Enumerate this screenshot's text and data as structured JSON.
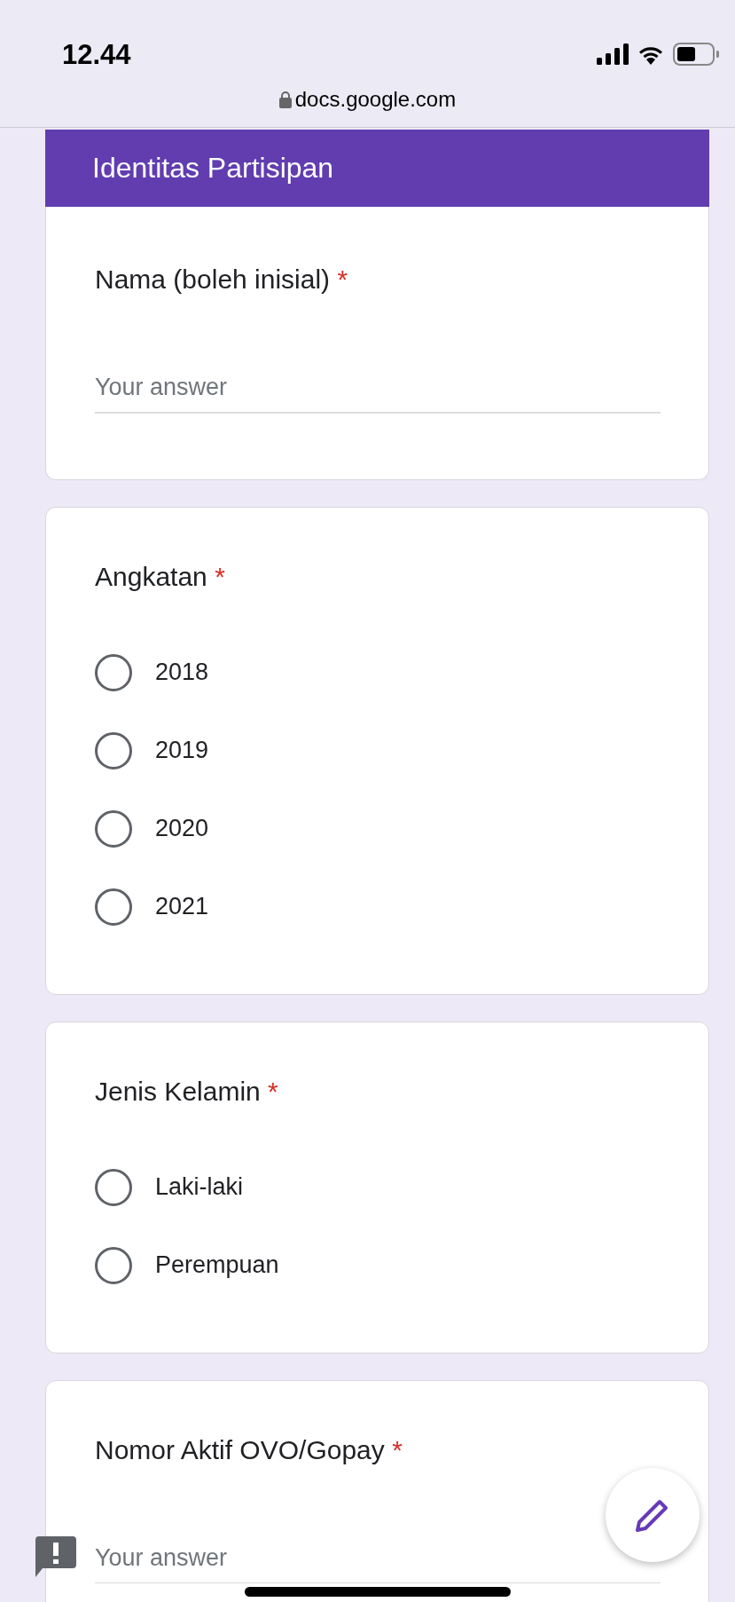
{
  "status_bar": {
    "time": "12.44"
  },
  "url_bar": {
    "url": "docs.google.com"
  },
  "form": {
    "section_title": "Identitas Partisipan",
    "questions": [
      {
        "kind": "text",
        "title": "Nama (boleh inisial)",
        "required_mark": "*",
        "placeholder": "Your answer"
      },
      {
        "kind": "radio",
        "title": "Angkatan",
        "required_mark": "*",
        "options": [
          {
            "label": "2018",
            "selected": false
          },
          {
            "label": "2019",
            "selected": false
          },
          {
            "label": "2020",
            "selected": false
          },
          {
            "label": "2021",
            "selected": false
          }
        ]
      },
      {
        "kind": "radio",
        "title": "Jenis Kelamin",
        "required_mark": "*",
        "options": [
          {
            "label": "Laki-laki",
            "selected": false
          },
          {
            "label": "Perempuan",
            "selected": false
          }
        ]
      },
      {
        "kind": "text",
        "title": "Nomor Aktif OVO/Gopay",
        "required_mark": "*",
        "placeholder": "Your answer"
      }
    ]
  }
}
